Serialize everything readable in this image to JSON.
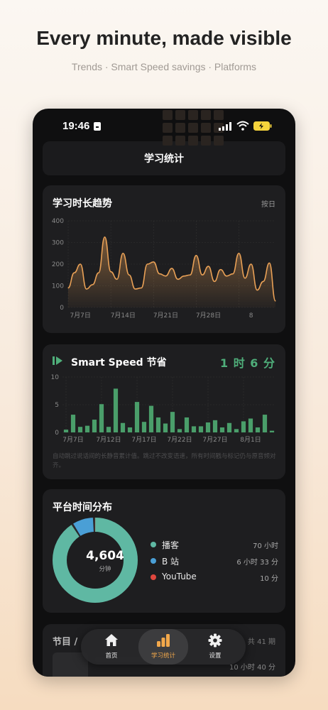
{
  "headline": "Every minute, made visible",
  "subline": "Trends · Smart Speed savings · Platforms",
  "status": {
    "time": "19:46"
  },
  "top_title": "学习统计",
  "trend": {
    "title": "学习时长趋势",
    "granularity": "按日",
    "chart_data": {
      "type": "area",
      "ylim": [
        0,
        400
      ],
      "yticks": [
        "0",
        "100",
        "200",
        "300",
        "400"
      ],
      "xticks": [
        "7月7日",
        "7月14日",
        "7月21日",
        "7月28日",
        "8"
      ],
      "color": "#e8a056",
      "values": [
        90,
        160,
        200,
        85,
        105,
        160,
        325,
        165,
        130,
        250,
        150,
        85,
        90,
        200,
        210,
        155,
        145,
        180,
        130,
        145,
        150,
        240,
        150,
        190,
        120,
        175,
        145,
        155,
        250,
        135,
        200,
        80,
        120,
        205,
        30
      ]
    }
  },
  "speed": {
    "title": "Smart Speed 节省",
    "total": "1 时 6 分",
    "note": "自动跳过说话间的长静音累计值。跳过不改变语速，所有时间戳与标记仍与原音频对齐。",
    "chart_data": {
      "type": "bar",
      "ylim": [
        0,
        10
      ],
      "yticks": [
        "0",
        "5",
        "10"
      ],
      "xticks": [
        "7月7日",
        "7月12日",
        "7月17日",
        "7月22日",
        "7月27日",
        "8月1日"
      ],
      "color": "#4a9e6a",
      "values": [
        0.5,
        3.2,
        1,
        1.2,
        2.3,
        5.1,
        1,
        7.9,
        1.7,
        0.9,
        5.5,
        1.9,
        4.8,
        2.7,
        1.6,
        3.7,
        0.6,
        2.7,
        1.1,
        1.1,
        1.8,
        2.2,
        0.9,
        1.7,
        0.6,
        2,
        2.5,
        0.9,
        3.2,
        0.3
      ]
    }
  },
  "platforms": {
    "title": "平台时间分布",
    "total_value": "4,604",
    "total_unit": "分钟",
    "chart_data": {
      "type": "pie",
      "labels": [
        "播客",
        "B 站",
        "YouTube"
      ],
      "minutes": [
        4200,
        393,
        10
      ],
      "colors": [
        "#5fb8a3",
        "#4a9fd6",
        "#e0473e"
      ]
    },
    "items": [
      {
        "name": "播客",
        "value": "70 小时",
        "color": "#5fb8a3"
      },
      {
        "name": "B 站",
        "value": "6 小时 33 分",
        "color": "#4a9fd6"
      },
      {
        "name": "YouTube",
        "value": "10 分",
        "color": "#e0473e"
      }
    ]
  },
  "episodes": {
    "title": "节目 /",
    "count": "共 41 期",
    "duration": "10 小时 40 分"
  },
  "tabs": [
    {
      "label": "首页",
      "icon": "home-icon"
    },
    {
      "label": "学习统计",
      "icon": "stats-icon",
      "active": true
    },
    {
      "label": "设置",
      "icon": "gear-icon"
    }
  ]
}
